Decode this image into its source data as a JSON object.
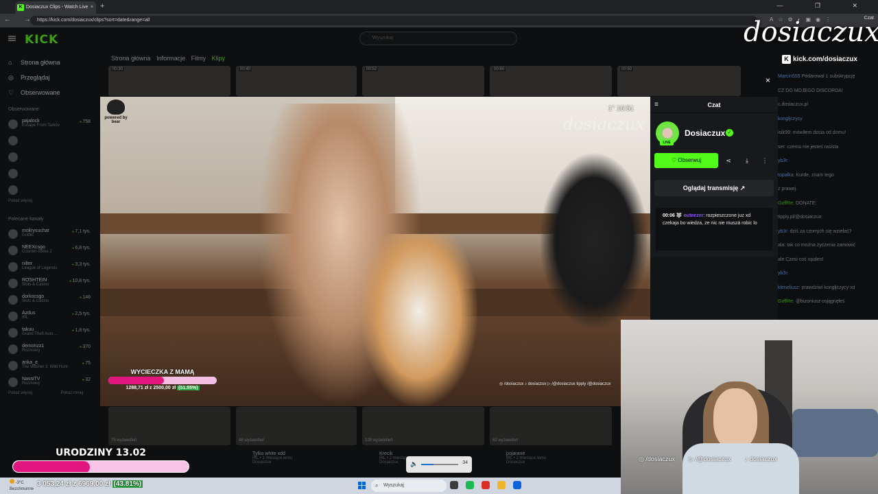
{
  "browser": {
    "tab_title": "Dosiaczux Clips - Watch Live",
    "tab_close": "×",
    "new_tab": "+",
    "url": "https://kick.com/dosiaczux/clips?sort=date&range=all",
    "chat_button": "Czat",
    "nav_glyphs": "← → ⟳",
    "window_controls": "— ❐ ✕",
    "extension_glyphs": "A☆⚙◐▣◉⋮"
  },
  "kick": {
    "logo": "KICK",
    "search_placeholder": "Wyszukaj",
    "sidebar_main": [
      {
        "label": "Strona główna",
        "icon": "⌂"
      },
      {
        "label": "Przeglądaj",
        "icon": "◎"
      },
      {
        "label": "Obserwowane",
        "icon": "♡"
      }
    ],
    "followed_header": "Obserwowane",
    "followed": [
      {
        "name": "pajalock",
        "game": "Escape From Tarkov",
        "viewers": "758"
      },
      {
        "name": "",
        "game": "",
        "viewers": ""
      },
      {
        "name": "",
        "game": "",
        "viewers": ""
      },
      {
        "name": "",
        "game": "",
        "viewers": ""
      },
      {
        "name": "",
        "game": "",
        "viewers": ""
      }
    ],
    "show_more": "Pokaż więcej",
    "recommended_header": "Polecane kanały",
    "recommended": [
      {
        "name": "mokrysuchar",
        "game": "Gothic",
        "viewers": "7,1 tys."
      },
      {
        "name": "NEEXcsgo",
        "game": "Counter-Strike 2",
        "viewers": "6,8 tys."
      },
      {
        "name": "nilter",
        "game": "League of Legends",
        "viewers": "3,3 tys."
      },
      {
        "name": "ROSHTEIN",
        "game": "Slots & Casino",
        "viewers": "10,8 tys."
      },
      {
        "name": "dorkocsgo",
        "game": "Slots & Casino",
        "viewers": "146"
      },
      {
        "name": "Azdus",
        "game": "IRL",
        "viewers": "2,5 tys."
      },
      {
        "name": "takuu",
        "game": "Grand Theft Auto ...",
        "viewers": "1,8 tys."
      },
      {
        "name": "demonzz1",
        "game": "Rozmowy",
        "viewers": "370"
      },
      {
        "name": "anka_e",
        "game": "The Witcher 3: Wild Hunt",
        "viewers": "75"
      },
      {
        "name": "NassiTV",
        "game": "Rozmowy",
        "viewers": "32"
      }
    ],
    "recommended_more": "Pokaż więcej",
    "recommended_less": "Pokaż mniej",
    "tabs": [
      "Strona główna",
      "Informacje",
      "Filmy",
      "Klipy"
    ],
    "clip_durations": [
      "00:30",
      "00:40",
      "00:52",
      "00:60",
      "00:50"
    ],
    "bottom_clips": [
      {
        "views": "75 wyświetleń",
        "title": "",
        "meta": "",
        "channel": ""
      },
      {
        "views": "48 wyświetleń",
        "title": "Tylko white xdd",
        "meta": "IRL • 2 miesiące temu",
        "channel": "Dosiaczux"
      },
      {
        "views": "109 wyświetleń",
        "title": "Krecik",
        "meta": "IRL • 2 miesiące temu",
        "channel": "Dosiaczux"
      },
      {
        "views": "62 wyświetleń",
        "title": "pojarane",
        "meta": "IRL • 2 miesiące temu",
        "channel": "Dosiaczux"
      }
    ]
  },
  "right_chat": {
    "messages": [
      {
        "user": "Marcin555",
        "text": "Podarował 1 subskrypcję",
        "g": false
      },
      {
        "user": "",
        "text": "CZ DO MOJEGO DISCORDA!",
        "g": false
      },
      {
        "user": "",
        "text": "c.dosiaczux.pl",
        "g": false
      },
      {
        "user": "kongljczycy",
        "text": "",
        "g": false
      },
      {
        "user": "",
        "text": "isik99: mówiłem dosia od domu!",
        "g": false
      },
      {
        "user": "",
        "text": "ser: czemu nie jesteś rasista",
        "g": false
      },
      {
        "user": "yb3r:",
        "text": "",
        "g": false
      },
      {
        "user": "topalka:",
        "text": "Kurde, znam tego",
        "g": false
      },
      {
        "user": "",
        "text": "z prawej.",
        "g": false
      },
      {
        "user": "GoffRe:",
        "text": "DONATE:",
        "g": true
      },
      {
        "user": "",
        "text": "tipply.pl/@dosiaczux",
        "g": false
      },
      {
        "user": "yb3r:",
        "text": "dziś za czorrych się wziełaś?",
        "g": false
      },
      {
        "user": "",
        "text": "ala: tak co można życzenia zamowić",
        "g": false
      },
      {
        "user": "",
        "text": "ale Czesi coś opalen!",
        "g": false
      },
      {
        "user": "yb3r:",
        "text": "",
        "g": false
      },
      {
        "user": "kleneliusz:",
        "text": "prawdziwi kongljczycy xd",
        "g": false
      },
      {
        "user": "GoffRe:",
        "text": "@bizoniusz osjągnęłeś",
        "g": true
      }
    ]
  },
  "modal": {
    "close": "×",
    "video": {
      "powered_by": "powered by",
      "powered_brand": "bear",
      "clock": "1° 16:51",
      "watermark": "dosiaczux",
      "goal_title": "WYCIECZKA Z MAMĄ",
      "goal_amount": "1288,71 zł z 2500,00 zł",
      "goal_percent": "(51.55%)",
      "goal_fraction": 0.5155,
      "socials": "◎ /dosiaczux   ♪ dosiaczux   ▷ /@dosiaczux   tipply /@dosiaczux"
    },
    "chat": {
      "title": "Czat",
      "menu_glyph": "≡",
      "streamer": "Dosiaczux",
      "live_badge": "LIVE",
      "verified_glyph": "✓",
      "follow_button": "♡ Obserwuj",
      "icon_glyphs": [
        "⋖",
        "⤓",
        "⋮"
      ],
      "watch_button": "Oglądaj transmisję ↗",
      "message": {
        "time": "00:06",
        "badge": "🐺",
        "user": "outeezer",
        "text": "rozpieszczone juz xd czekaja bo wiedza, ze nic nie musza robic lo"
      }
    }
  },
  "overlay": {
    "stream_logo": "dosiaczux",
    "stream_url": "kick.com/dosiaczux",
    "kick_glyph": "K",
    "bday_title": "URODZINY 13.02",
    "bday_amount": "3 053,24 zł z 6969,00 zł",
    "bday_percent": "(43.81%)",
    "bday_fraction": 0.4381,
    "volume": "34",
    "volume_glyph": "🔈",
    "volume_fraction": 0.34,
    "webcam_socials": [
      "◎ /dosiaczux",
      "▷ /@dosiaczux",
      "♪ dosiaczux"
    ]
  },
  "taskbar": {
    "weather_temp": "-3°C",
    "weather_desc": "Bezchmurnie",
    "search": "Wyszukaj",
    "search_glyph": "⌕",
    "app_colors": [
      "#3d3d3d",
      "#1db954",
      "#d93025",
      "#f0b429",
      "#0a64d8"
    ]
  }
}
